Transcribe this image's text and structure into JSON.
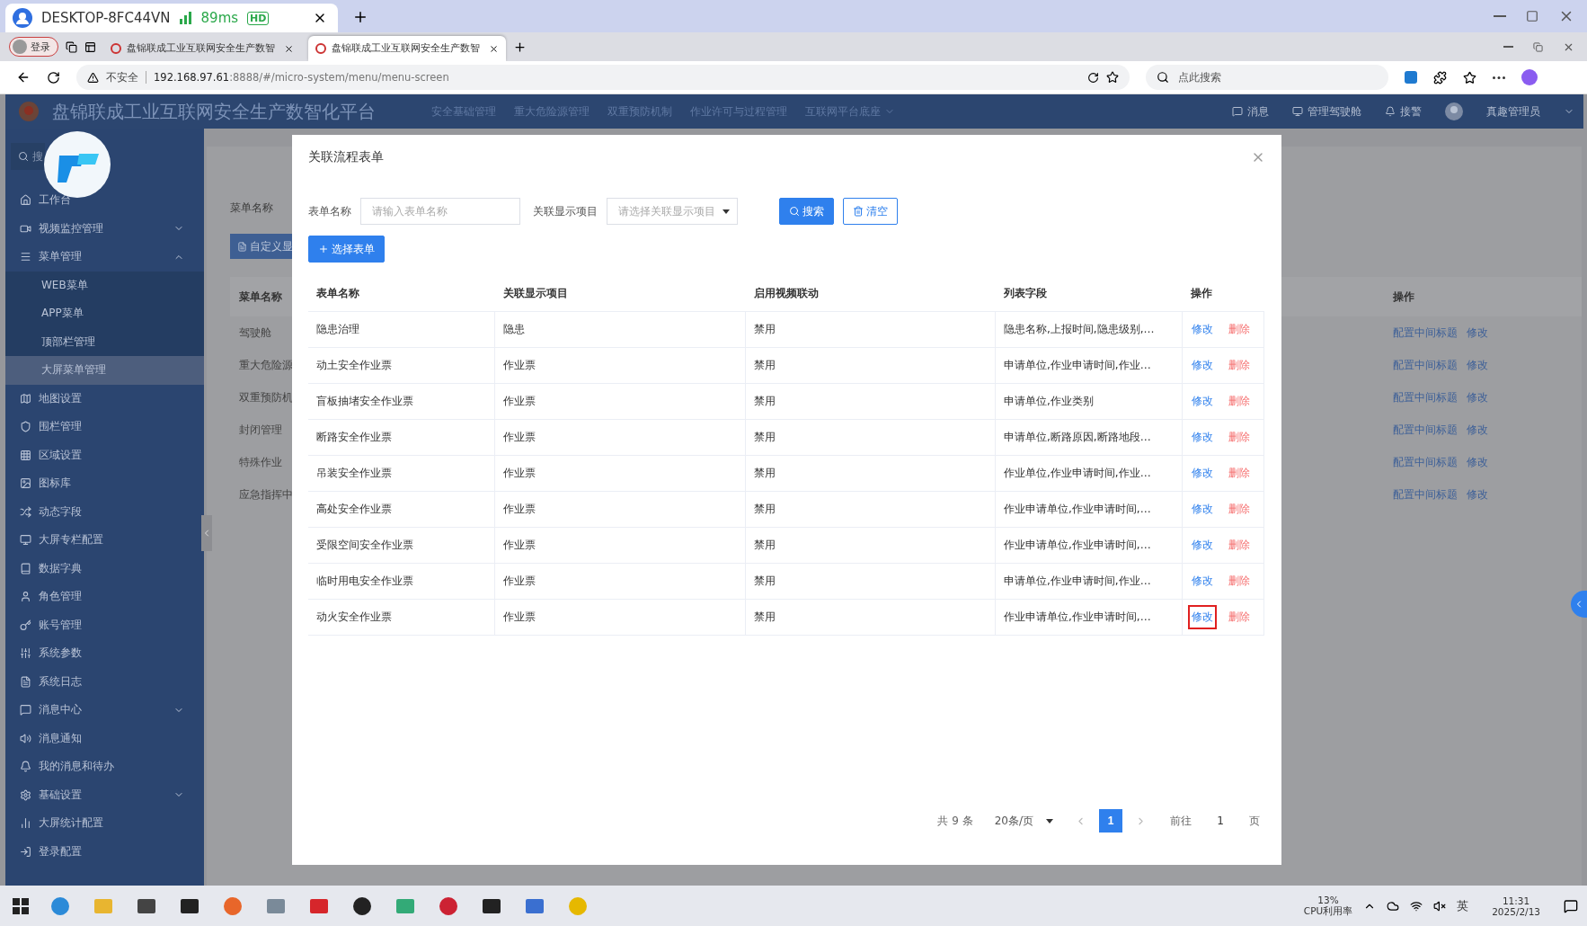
{
  "remote_bar": {
    "host": "DESKTOP-8FC44VN",
    "latency": "89ms",
    "quality": "HD"
  },
  "browser": {
    "login": "登录",
    "tabs": [
      {
        "title": "盘锦联成工业互联网安全生产数智",
        "selected": false
      },
      {
        "title": "盘锦联成工业互联网安全生产数智",
        "selected": true
      }
    ],
    "security": "不安全",
    "url_host": "192.168.97.61",
    "url_rest": ":8888/#/micro-system/menu/menu-screen",
    "search_placeholder": "点此搜索"
  },
  "app": {
    "title": "盘锦联成工业互联网安全生产数智化平台",
    "nav": [
      {
        "label": "安全基础管理",
        "dropdown": false
      },
      {
        "label": "重大危险源管理",
        "dropdown": false
      },
      {
        "label": "双重预防机制",
        "dropdown": false
      },
      {
        "label": "作业许可与过程管理",
        "dropdown": false
      },
      {
        "label": "互联网平台底座",
        "dropdown": true
      }
    ],
    "tools": [
      {
        "kind": "message",
        "label": "消息"
      },
      {
        "kind": "cockpit",
        "label": "管理驾驶舱"
      },
      {
        "kind": "alarm",
        "label": "接警"
      }
    ],
    "user": "真趣管理员"
  },
  "sidebar": {
    "search_placeholder": "搜",
    "items": [
      {
        "label": "工作台",
        "selected": false
      },
      {
        "label": "视频监控管理",
        "selected": false,
        "expanded": false
      },
      {
        "label": "菜单管理",
        "selected": false,
        "expanded": true,
        "children": [
          {
            "label": "WEB菜单",
            "selected": false
          },
          {
            "label": "APP菜单",
            "selected": false
          },
          {
            "label": "顶部栏管理",
            "selected": false
          },
          {
            "label": "大屏菜单管理",
            "selected": true
          }
        ]
      },
      {
        "label": "地图设置",
        "selected": false
      },
      {
        "label": "围栏管理",
        "selected": false
      },
      {
        "label": "区域设置",
        "selected": false
      },
      {
        "label": "图标库",
        "selected": false
      },
      {
        "label": "动态字段",
        "selected": false
      },
      {
        "label": "大屏专栏配置",
        "selected": false
      },
      {
        "label": "数据字典",
        "selected": false
      },
      {
        "label": "角色管理",
        "selected": false
      },
      {
        "label": "账号管理",
        "selected": false
      },
      {
        "label": "系统参数",
        "selected": false
      },
      {
        "label": "系统日志",
        "selected": false
      },
      {
        "label": "消息中心",
        "selected": false,
        "expanded": false
      },
      {
        "label": "消息通知",
        "selected": false
      },
      {
        "label": "我的消息和待办",
        "selected": false
      },
      {
        "label": "基础设置",
        "selected": false,
        "expanded": false
      },
      {
        "label": "大屏统计配置",
        "selected": false
      },
      {
        "label": "登录配置",
        "selected": false
      }
    ]
  },
  "background_page": {
    "filter_label": "菜单名称",
    "custom_button": "自定义显",
    "columns": [
      "菜单名称",
      "操作"
    ],
    "rows": [
      {
        "name": "驾驶舱",
        "actions": [
          "配置中间标题",
          "修改"
        ]
      },
      {
        "name": "重大危险源",
        "actions": [
          "配置中间标题",
          "修改"
        ]
      },
      {
        "name": "双重预防机",
        "actions": [
          "配置中间标题",
          "修改"
        ]
      },
      {
        "name": "封闭管理",
        "actions": [
          "配置中间标题",
          "修改"
        ]
      },
      {
        "name": "特殊作业",
        "actions": [
          "配置中间标题",
          "修改"
        ]
      },
      {
        "name": "应急指挥中",
        "actions": [
          "配置中间标题",
          "修改"
        ]
      }
    ]
  },
  "dialog": {
    "title": "关联流程表单",
    "filters": [
      {
        "label": "表单名称",
        "kind": "input",
        "placeholder": "请输入表单名称"
      },
      {
        "label": "关联显示项目",
        "kind": "select",
        "placeholder": "请选择关联显示项目"
      }
    ],
    "search_button": "搜索",
    "clear_button": "清空",
    "add_button": "选择表单",
    "columns": [
      "表单名称",
      "关联显示项目",
      "启用视频联动",
      "列表字段",
      "操作"
    ],
    "rows": [
      {
        "name": "隐患治理",
        "item": "隐患",
        "video": "禁用",
        "fields": "隐患名称,上报时间,隐患级别,…",
        "edit": "修改",
        "delete": "删除",
        "edit_highlighted": false
      },
      {
        "name": "动土安全作业票",
        "item": "作业票",
        "video": "禁用",
        "fields": "申请单位,作业申请时间,作业…",
        "edit": "修改",
        "delete": "删除",
        "edit_highlighted": false
      },
      {
        "name": "盲板抽堵安全作业票",
        "item": "作业票",
        "video": "禁用",
        "fields": "申请单位,作业类别",
        "edit": "修改",
        "delete": "删除",
        "edit_highlighted": false
      },
      {
        "name": "断路安全作业票",
        "item": "作业票",
        "video": "禁用",
        "fields": "申请单位,断路原因,断路地段…",
        "edit": "修改",
        "delete": "删除",
        "edit_highlighted": false
      },
      {
        "name": "吊装安全作业票",
        "item": "作业票",
        "video": "禁用",
        "fields": "作业单位,作业申请时间,作业…",
        "edit": "修改",
        "delete": "删除",
        "edit_highlighted": false
      },
      {
        "name": "高处安全作业票",
        "item": "作业票",
        "video": "禁用",
        "fields": "作业申请单位,作业申请时间,…",
        "edit": "修改",
        "delete": "删除",
        "edit_highlighted": false
      },
      {
        "name": "受限空间安全作业票",
        "item": "作业票",
        "video": "禁用",
        "fields": "作业申请单位,作业申请时间,…",
        "edit": "修改",
        "delete": "删除",
        "edit_highlighted": false
      },
      {
        "name": "临时用电安全作业票",
        "item": "作业票",
        "video": "禁用",
        "fields": "申请单位,作业申请时间,作业…",
        "edit": "修改",
        "delete": "删除",
        "edit_highlighted": false
      },
      {
        "name": "动火安全作业票",
        "item": "作业票",
        "video": "禁用",
        "fields": "作业申请单位,作业申请时间,…",
        "edit": "修改",
        "delete": "删除",
        "edit_highlighted": true
      }
    ],
    "pagination": {
      "total": "共 9 条",
      "page_size": "20条/页",
      "pages": [
        {
          "label": "1",
          "selected": true
        }
      ],
      "goto_label": "前往",
      "goto_value": "1",
      "goto_suffix": "页"
    }
  },
  "taskbar": {
    "cpu": "13%",
    "cpu_label": "CPU利用率",
    "ime": "英",
    "time": "11:31",
    "date": "2025/2/13"
  }
}
